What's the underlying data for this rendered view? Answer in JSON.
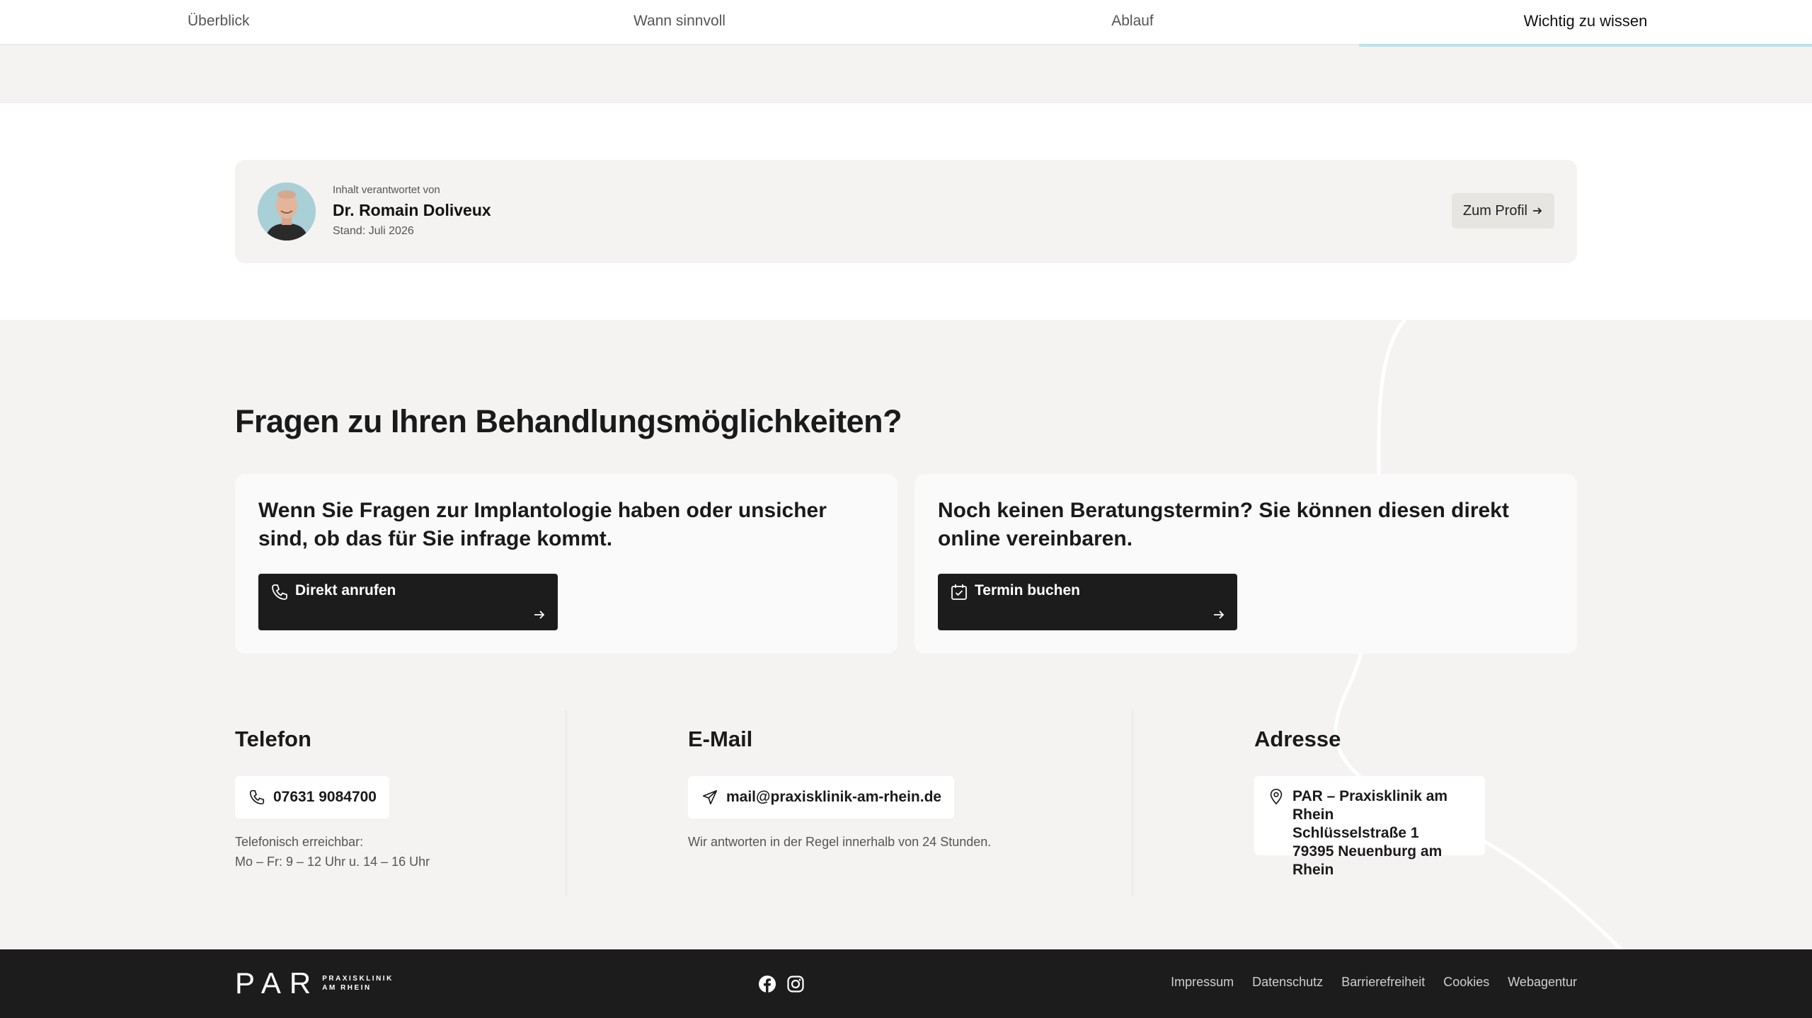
{
  "tabs": [
    {
      "label": "Überblick"
    },
    {
      "label": "Wann sinnvoll"
    },
    {
      "label": "Ablauf"
    },
    {
      "label": "Wichtig zu wissen"
    }
  ],
  "author": {
    "caption": "Inhalt verantwortet von",
    "name": "Dr. Romain Doliveux",
    "date": "Stand: Juli 2026",
    "profile_label": "Zum Profil"
  },
  "cta": {
    "heading": "Fragen zu Ihren Behandlungsmöglichkeiten?",
    "cards": [
      {
        "text": "Wenn Sie Fragen zur Implantologie haben oder unsicher sind, ob das für Sie infrage kommt.",
        "button": "Direkt anrufen",
        "icon": "phone-icon"
      },
      {
        "text": "Noch keinen Beratungstermin? Sie können diesen direkt online vereinbaren.",
        "button": "Termin buchen",
        "icon": "calendar-check-icon"
      }
    ]
  },
  "contact": {
    "phone": {
      "title": "Telefon",
      "value": "07631 9084700",
      "hours_label": "Telefonisch erreichbar:",
      "hours": "Mo – Fr: 9 – 12 Uhr u. 14 – 16 Uhr"
    },
    "email": {
      "title": "E-Mail",
      "value": "mail@praxisklinik-am-rhein.de",
      "note": "Wir antworten in der Regel innerhalb von 24 Stunden."
    },
    "address": {
      "title": "Adresse",
      "lines": [
        "PAR – Praxisklinik am Rhein",
        "Schlüsselstraße 1",
        "79395 Neuenburg am Rhein"
      ]
    }
  },
  "footer": {
    "logo_main": "PAR",
    "logo_sub1": "PRAXISKLINIK",
    "logo_sub2": "AM RHEIN",
    "links": [
      "Impressum",
      "Datenschutz",
      "Barrierefreiheit",
      "Cookies",
      "Webagentur"
    ]
  },
  "colors": {
    "accent_underline": "#b9e2ec",
    "button_dark": "#1c1c1c",
    "background": "#f4f3f1"
  }
}
